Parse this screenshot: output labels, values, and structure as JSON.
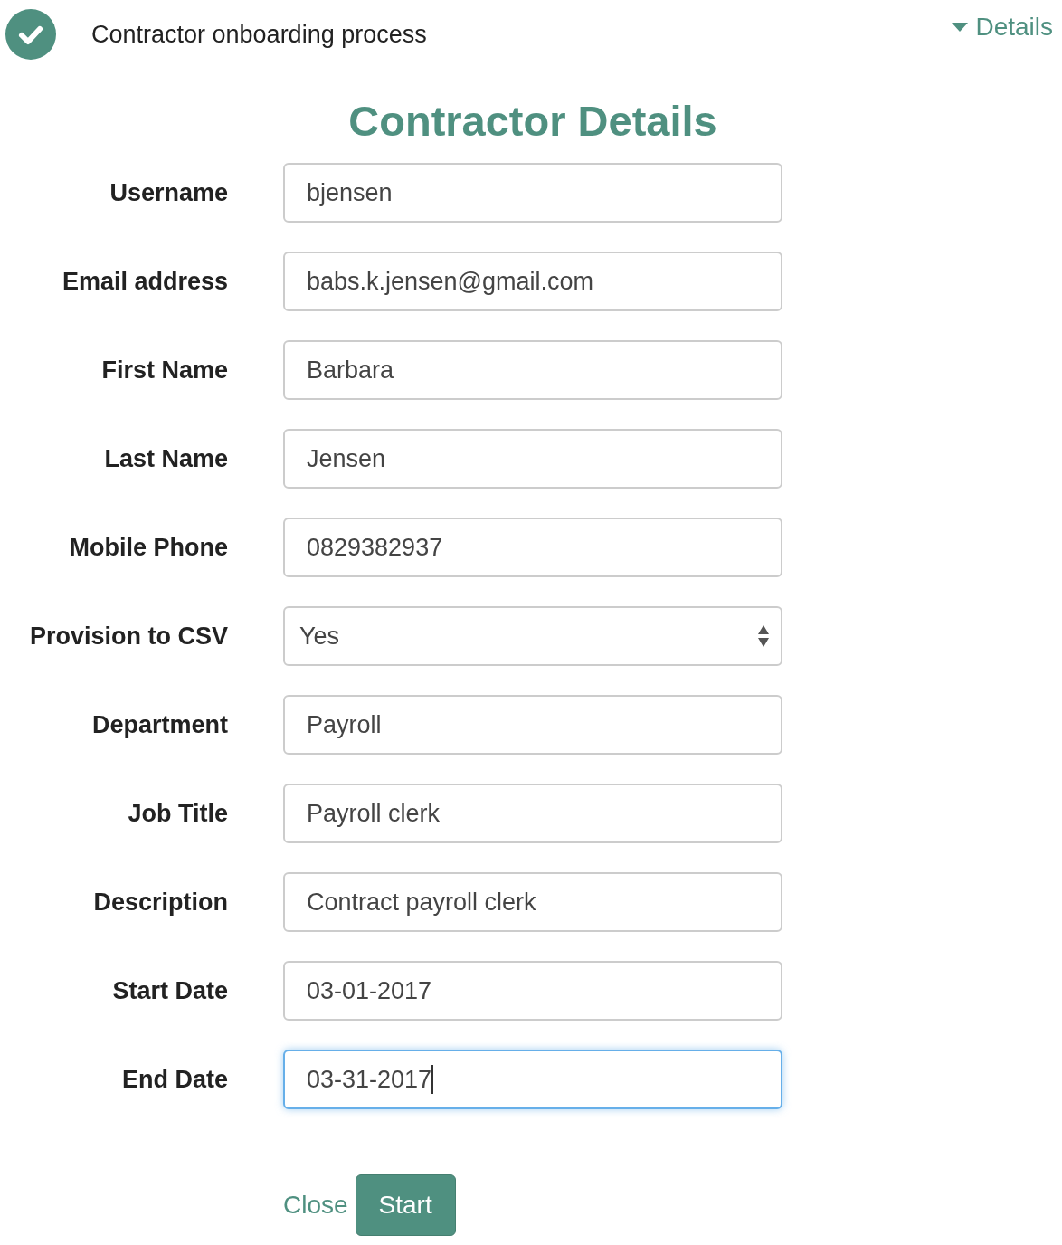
{
  "header": {
    "done": true,
    "title": "Contractor onboarding process",
    "details_toggle": {
      "label": "Details",
      "expanded": false
    }
  },
  "heading": "Contractor Details",
  "fields": [
    {
      "label": "Username",
      "kind": "text",
      "value": "bjensen",
      "focused": false
    },
    {
      "label": "Email address",
      "kind": "text",
      "value": "babs.k.jensen@gmail.com",
      "focused": false
    },
    {
      "label": "First Name",
      "kind": "text",
      "value": "Barbara",
      "focused": false
    },
    {
      "label": "Last Name",
      "kind": "text",
      "value": "Jensen",
      "focused": false
    },
    {
      "label": "Mobile Phone",
      "kind": "text",
      "value": "0829382937",
      "focused": false
    },
    {
      "label": "Provision to CSV",
      "kind": "select",
      "value": "Yes",
      "focused": false
    },
    {
      "label": "Department",
      "kind": "text",
      "value": "Payroll",
      "focused": false
    },
    {
      "label": "Job Title",
      "kind": "text",
      "value": "Payroll clerk",
      "focused": false
    },
    {
      "label": "Description",
      "kind": "text",
      "value": "Contract payroll clerk",
      "focused": false
    },
    {
      "label": "Start Date",
      "kind": "text",
      "value": "03-01-2017",
      "focused": false
    },
    {
      "label": "End Date",
      "kind": "text",
      "value": "03-31-2017",
      "focused": true
    }
  ],
  "buttons": {
    "close": "Close",
    "start": "Start"
  }
}
